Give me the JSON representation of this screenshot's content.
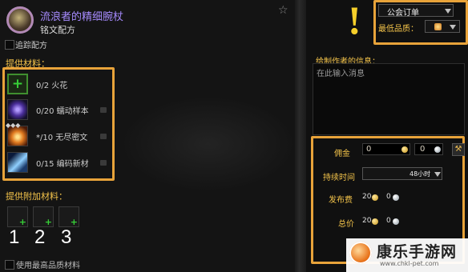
{
  "recipe": {
    "name": "流浪者的精细腕杖",
    "category": "铭文配方",
    "track_label": "追踪配方"
  },
  "reagents": {
    "title": "提供材料：",
    "items": [
      {
        "label": "0/2 火花",
        "icon": "plus-icon"
      },
      {
        "label": "0/20 蠕动样本",
        "icon": "swirl-icon"
      },
      {
        "label": "*/10 无尽密文",
        "icon": "fire-icon"
      },
      {
        "label": "0/15 编码新材",
        "icon": "comet-icon"
      }
    ]
  },
  "optional": {
    "title": "提供附加材料：",
    "slot_numbers": [
      "1",
      "2",
      "3"
    ],
    "best_quality_label": "使用最高品质材料"
  },
  "order": {
    "type": "公会订单",
    "min_quality_label": "最低品质：",
    "message_title": "给制作者的信息：",
    "message_placeholder": "在此输入消息",
    "commission_label": "佣金",
    "commission_gold": "0",
    "commission_silver": "0",
    "duration_label": "持续时间",
    "duration_value": "48小时",
    "fee_label": "发布费",
    "fee_gold": "20",
    "fee_silver": "0",
    "total_label": "总价",
    "total_gold": "20",
    "total_silver": "0"
  },
  "watermark": {
    "name": "康乐手游网",
    "url": "www.chkl-pet.com"
  },
  "colors": {
    "highlight": "#e8a33a",
    "title_gold": "#f3c34a",
    "recipe_name": "#a78bff"
  }
}
